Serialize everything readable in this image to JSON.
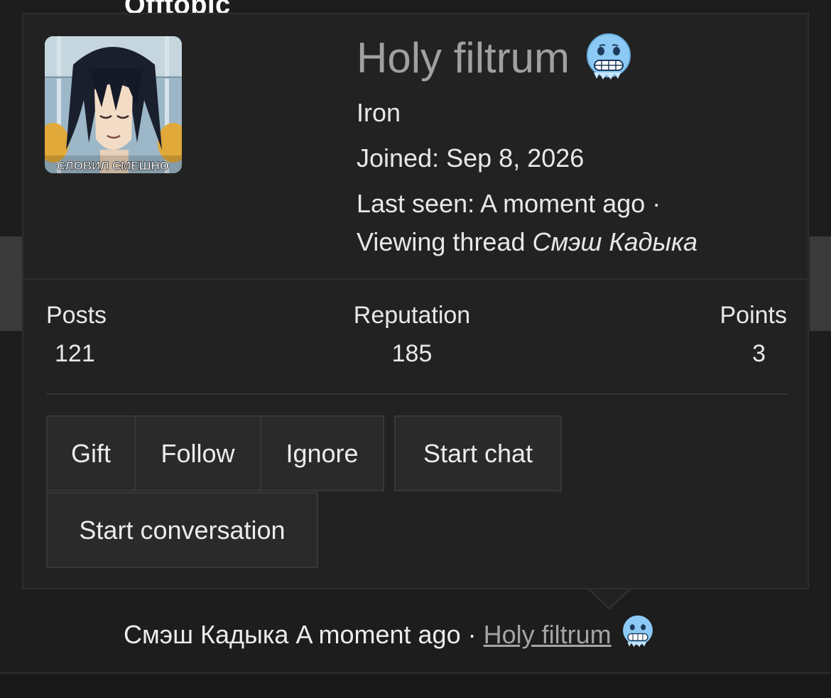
{
  "background": {
    "section_title": "Offtopic"
  },
  "profile": {
    "avatar_caption": "СЛОВИЛ СМЕШНО",
    "name": "Holy filtrum",
    "name_emoji": "cold-face-emoji",
    "rank": "Iron",
    "joined_label": "Joined:",
    "joined_date": "Sep 8, 2026",
    "last_seen_label": "Last seen:",
    "last_seen_value": "A moment ago",
    "separator": "·",
    "viewing_text": "Viewing thread",
    "viewing_thread": "Смэш Кадыка"
  },
  "stats": {
    "posts_label": "Posts",
    "posts_value": "121",
    "reputation_label": "Reputation",
    "reputation_value": "185",
    "points_label": "Points",
    "points_value": "3"
  },
  "actions": {
    "gift": "Gift",
    "follow": "Follow",
    "ignore": "Ignore",
    "start_chat": "Start chat",
    "start_conversation": "Start conversation"
  },
  "footer": {
    "thread_title": "Смэш Кадыка",
    "time": "A moment ago",
    "separator": "·",
    "author": "Holy filtrum"
  },
  "colors": {
    "background": "#1d1d1d",
    "popup_bg": "#222222",
    "button_bg": "#2a2a2a",
    "username_gray": "#a0a0a0",
    "emoji_blue": "#8ccaf5"
  }
}
